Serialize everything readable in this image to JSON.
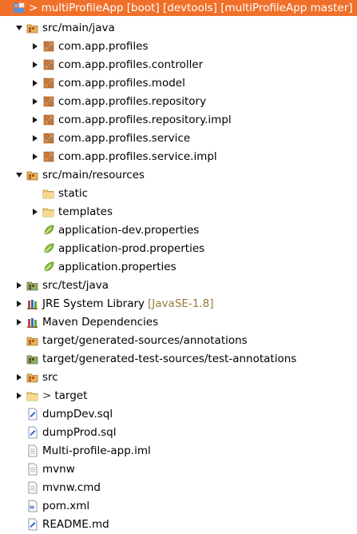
{
  "tree": {
    "root": {
      "prefix": ">",
      "label": "multiProfileApp [boot] [devtools] [multiProfileApp master]"
    },
    "src_main_java": {
      "label": "src/main/java",
      "packages": [
        "com.app.profiles",
        "com.app.profiles.controller",
        "com.app.profiles.model",
        "com.app.profiles.repository",
        "com.app.profiles.repository.impl",
        "com.app.profiles.service",
        "com.app.profiles.service.impl"
      ]
    },
    "src_main_resources": {
      "label": "src/main/resources",
      "static": "static",
      "templates": "templates",
      "files": [
        "application-dev.properties",
        "application-prod.properties",
        "application.properties"
      ]
    },
    "src_test_java": "src/test/java",
    "jre": {
      "label": "JRE System Library",
      "decoration": "[JavaSE-1.8]"
    },
    "maven": "Maven Dependencies",
    "gen_sources": "target/generated-sources/annotations",
    "gen_test_sources": "target/generated-test-sources/test-annotations",
    "src": "src",
    "target": {
      "prefix": ">",
      "label": "target"
    },
    "files": [
      "dumpDev.sql",
      "dumpProd.sql",
      "Multi-profile-app.iml",
      "mvnw",
      "mvnw.cmd",
      "pom.xml",
      "README.md"
    ]
  }
}
